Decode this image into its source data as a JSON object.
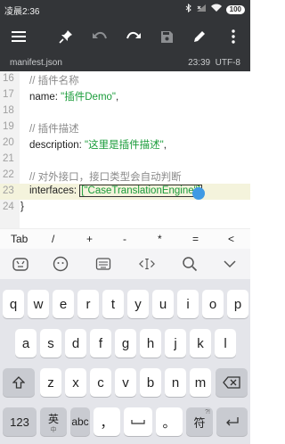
{
  "status": {
    "time": "凌晨2:36",
    "battery": "100"
  },
  "file": {
    "name": "manifest.json",
    "time": "23:39",
    "encoding": "UTF-8"
  },
  "lines": [
    {
      "num": "16",
      "text": "// 插件名称",
      "kind": "comment"
    },
    {
      "num": "17",
      "key": "name: ",
      "str": "\"插件Demo\"",
      "tail": ",",
      "kind": "kv"
    },
    {
      "num": "18",
      "text": "",
      "kind": "blank"
    },
    {
      "num": "19",
      "text": "// 插件描述",
      "kind": "comment"
    },
    {
      "num": "20",
      "key": "description: ",
      "str": "\"这里是插件描述\"",
      "tail": ",",
      "kind": "kv"
    },
    {
      "num": "21",
      "text": "",
      "kind": "blank"
    },
    {
      "num": "22",
      "text": "// 对外接口，接口类型会自动判断",
      "kind": "comment"
    },
    {
      "num": "23",
      "key": "interfaces: ",
      "str": "[\"CaseTranslationEngine\"]",
      "tail": "",
      "kind": "kv"
    },
    {
      "num": "24",
      "text": "}",
      "kind": "plain"
    }
  ],
  "symbols": [
    "Tab",
    "/",
    "+",
    "-",
    "*",
    "=",
    "<"
  ],
  "kb_tools": [
    "keyboard-icon",
    "emoji-icon",
    "mini-keyboard-icon",
    "cursor-move-icon",
    "search-icon",
    "collapse-icon"
  ],
  "keyboard": {
    "row1": [
      "q",
      "w",
      "e",
      "r",
      "t",
      "y",
      "u",
      "i",
      "o",
      "p"
    ],
    "row2": [
      "a",
      "s",
      "d",
      "f",
      "g",
      "h",
      "j",
      "k",
      "l"
    ],
    "row3": [
      "z",
      "x",
      "c",
      "v",
      "b",
      "n",
      "m"
    ],
    "num": "123",
    "lang": "英",
    "lang_sub": "中",
    "abc": "abc",
    "comma": "，",
    "period": "。",
    "symbol": "符",
    "fn_key": "?!"
  }
}
